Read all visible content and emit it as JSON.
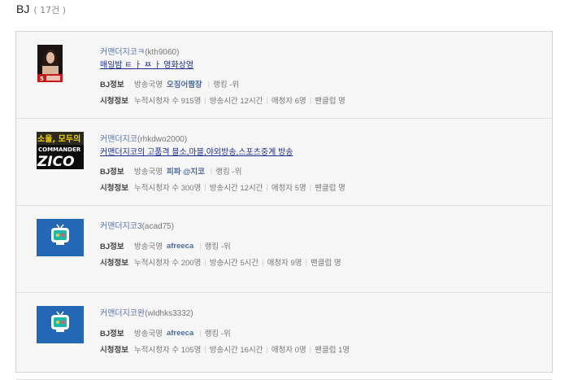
{
  "header": {
    "title": "BJ",
    "count": "( 17건 )"
  },
  "items": [
    {
      "channel": "커맨더지코ㅋ",
      "user_id": "(kth9060)",
      "broadcast_title": "매일밤 ㅌ ㅏ ㅉ ㅏ 영화상영",
      "bj_label": "BJ정보",
      "country_key": "방송국명",
      "country_val": "오징어짬장",
      "rank_text": "랭킹 -위",
      "stats_label": "시청정보",
      "viewers": "누적시청자 수 915명",
      "hours": "방송시간 12시간",
      "fans": "애청자 6명",
      "fanclub": "팬클럽 명",
      "thumb": "poster-thumbnail"
    },
    {
      "channel": "커맨더지코",
      "user_id": "(rhkdwo2000)",
      "broadcast_title": "커맨더지코의 고품격 블소,마블,야외방송,스포츠중계 방송",
      "bj_label": "BJ정보",
      "country_key": "방송국명",
      "country_val": "피파 @지코",
      "rank_text": "랭킹 -위",
      "stats_label": "시청정보",
      "viewers": "누적시청자 수 300명",
      "hours": "방송시간 12시간",
      "fans": "애청자 5명",
      "fanclub": "팬클럽 명",
      "thumb_text_top": "소울, 모두의",
      "thumb_text_mid": "COMMANDER",
      "thumb_text_bot": "ZICO",
      "thumb": "zico-thumbnail"
    },
    {
      "channel": "커맨더지코3",
      "user_id": "(acad75)",
      "bj_label": "BJ정보",
      "country_key": "방송국명",
      "country_val": "afreeca",
      "rank_text": "랭킹 -위",
      "stats_label": "시청정보",
      "viewers": "누적시청자 수 200명",
      "hours": "방송시간 5시간",
      "fans": "애청자 9명",
      "fanclub": "팬클럽 명",
      "thumb": "afreeca-tv-icon"
    },
    {
      "channel": "커맨더지코완",
      "user_id": "(wldhks3332)",
      "bj_label": "BJ정보",
      "country_key": "방송국명",
      "country_val": "afreeca",
      "rank_text": "랭킹 -위",
      "stats_label": "시청정보",
      "viewers": "누적시청자 수 105명",
      "hours": "방송시간 16시간",
      "fans": "애청자 0명",
      "fanclub": "팬클럽 1명",
      "thumb": "afreeca-tv-icon"
    }
  ],
  "colors": {
    "link": "#1a2c8a",
    "channel": "#5872a8",
    "value": "#4a6b9a",
    "panel_bg": "#f6f6f6",
    "tv_blue": "#2467b5"
  }
}
